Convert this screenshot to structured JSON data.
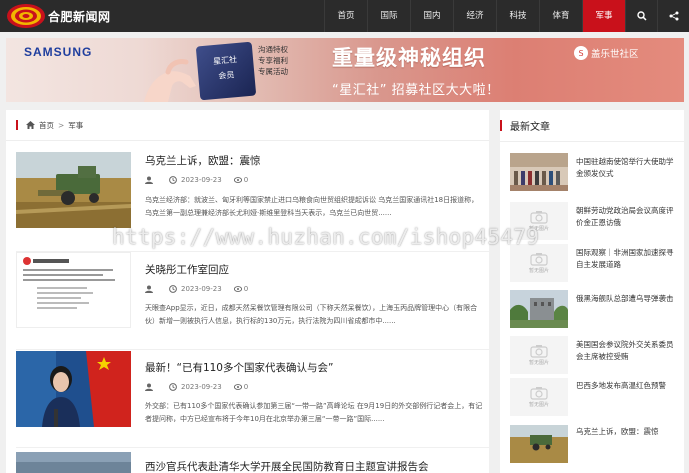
{
  "site": {
    "name": "合肥新闻网"
  },
  "nav": {
    "items": [
      {
        "label": "首页"
      },
      {
        "label": "国际"
      },
      {
        "label": "国内"
      },
      {
        "label": "经济"
      },
      {
        "label": "科技"
      },
      {
        "label": "体育"
      },
      {
        "label": "军事"
      }
    ],
    "search_icon": "search-icon",
    "share_icon": "share-icon"
  },
  "banner": {
    "brand": "SAMSUNG",
    "card_line1": "星汇社",
    "card_line2": "会员",
    "side_lines": [
      "沟通特权",
      "专享福利",
      "专属活动"
    ],
    "title": "重量级神秘组织",
    "subtitle": "“星汇社” 招募社区大大啦！",
    "logo_text": "盖乐世社区"
  },
  "breadcrumb": {
    "home": "首页",
    "separator": ">",
    "current": "军事"
  },
  "articles": [
    {
      "title": "乌克兰上诉，欧盟：震惊",
      "date": "2023-09-23",
      "comments": "0",
      "summary": "乌克兰经济部：就波兰、匈牙利等国家禁止进口乌粮食向世贸组织提起诉讼 乌克兰国家通讯社18日报道称，乌克兰第一副总理兼经济部长尤利娅·斯维里登科当天表示，乌克兰已向世贸......"
    },
    {
      "title": "关晓彤工作室回应",
      "date": "2023-09-23",
      "comments": "0",
      "summary": "天眼查App显示，近日，成都天然呆餐饮管理有限公司（下称天然呆餐饮），上海玉丙品牌管理中心（有限合伙）新增一则被执行人信息，执行标的130万元，执行法院为四川省成都市中......"
    },
    {
      "title": "最新！“已有110多个国家代表确认与会”",
      "date": "2023-09-23",
      "comments": "0",
      "summary": "外交部：已有110多个国家代表确认参加第三届“一带一路”高峰论坛 在9月19日的外交部例行记者会上，有记者提问称，中方已经宣布将于今年10月在北京举办第三届“一带一路”国际......"
    },
    {
      "title": "西沙官兵代表赴清华大学开展全民国防教育日主题宣讲报告会",
      "date": "",
      "comments": "",
      "summary": ""
    }
  ],
  "sidebar": {
    "title": "最新文章",
    "placeholder_label": "暂无图片",
    "items": [
      {
        "text": "中国驻越南使馆举行大使助学金颁发仪式"
      },
      {
        "text": "朝鲜劳动党政治局会议高度评价金正恩访俄"
      },
      {
        "text": "国际观察｜非洲国家加速探寻自主发展道路"
      },
      {
        "text": "俄黑海舰队总部遭乌导弹袭击"
      },
      {
        "text": "美国国会参议院外交关系委员会主席被控受贿"
      },
      {
        "text": "巴西多地发布高温红色预警"
      },
      {
        "text": "乌克兰上诉，欧盟：震惊"
      }
    ]
  },
  "watermark": "https://www.huzhan.com/ishop45479",
  "colors": {
    "header": "#2b2b2b",
    "accent": "#c9111b"
  }
}
